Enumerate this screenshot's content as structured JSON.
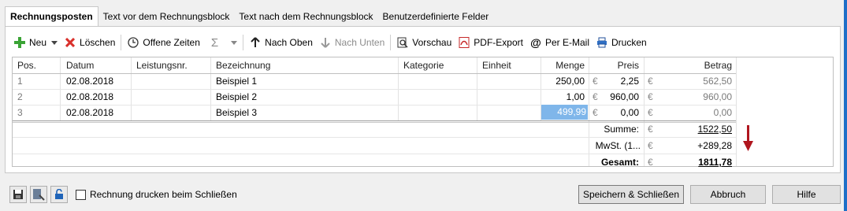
{
  "tabs": [
    {
      "label": "Rechnungsposten"
    },
    {
      "label": "Text vor dem Rechnungsblock"
    },
    {
      "label": "Text nach dem Rechnungsblock"
    },
    {
      "label": "Benutzerdefinierte Felder"
    }
  ],
  "toolbar": {
    "new": "Neu",
    "delete": "Löschen",
    "open_times": "Offene Zeiten",
    "sum_symbol": "Σ",
    "move_up": "Nach Oben",
    "move_down": "Nach Unten",
    "preview": "Vorschau",
    "pdf_export": "PDF-Export",
    "email": "Per E-Mail",
    "print": "Drucken"
  },
  "table": {
    "headers": {
      "pos": "Pos.",
      "datum": "Datum",
      "leistungsnr": "Leistungsnr.",
      "bezeichnung": "Bezeichnung",
      "kategorie": "Kategorie",
      "einheit": "Einheit",
      "menge": "Menge",
      "preis": "Preis",
      "betrag": "Betrag"
    },
    "currency": "€",
    "rows": [
      {
        "pos": "1",
        "datum": "02.08.2018",
        "leistungsnr": "",
        "bezeichnung": "Beispiel 1",
        "kategorie": "",
        "einheit": "",
        "menge": "250,00",
        "preis": "2,25",
        "betrag": "562,50"
      },
      {
        "pos": "2",
        "datum": "02.08.2018",
        "leistungsnr": "",
        "bezeichnung": "Beispiel 2",
        "kategorie": "",
        "einheit": "",
        "menge": "1,00",
        "preis": "960,00",
        "betrag": "960,00"
      },
      {
        "pos": "3",
        "datum": "02.08.2018",
        "leistungsnr": "",
        "bezeichnung": "Beispiel 3",
        "kategorie": "",
        "einheit": "",
        "menge": "499,99",
        "preis": "0,00",
        "betrag": "0,00"
      }
    ],
    "summary": {
      "sum_label": "Summe:",
      "sum_value": "1522,50",
      "vat_label": "MwSt. (1...",
      "vat_value": "+289,28",
      "total_label": "Gesamt:",
      "total_value": "1811,78"
    }
  },
  "colors": {
    "selection": "#7fb6ea",
    "arrow": "#b0161e",
    "add_icon": "#3aa335",
    "delete_icon": "#d9302b"
  },
  "footer": {
    "print_on_close_label": "Rechnung drucken beim Schließen",
    "print_on_close_checked": false,
    "save_close": "Speichern & Schließen",
    "cancel": "Abbruch",
    "help": "Hilfe"
  }
}
